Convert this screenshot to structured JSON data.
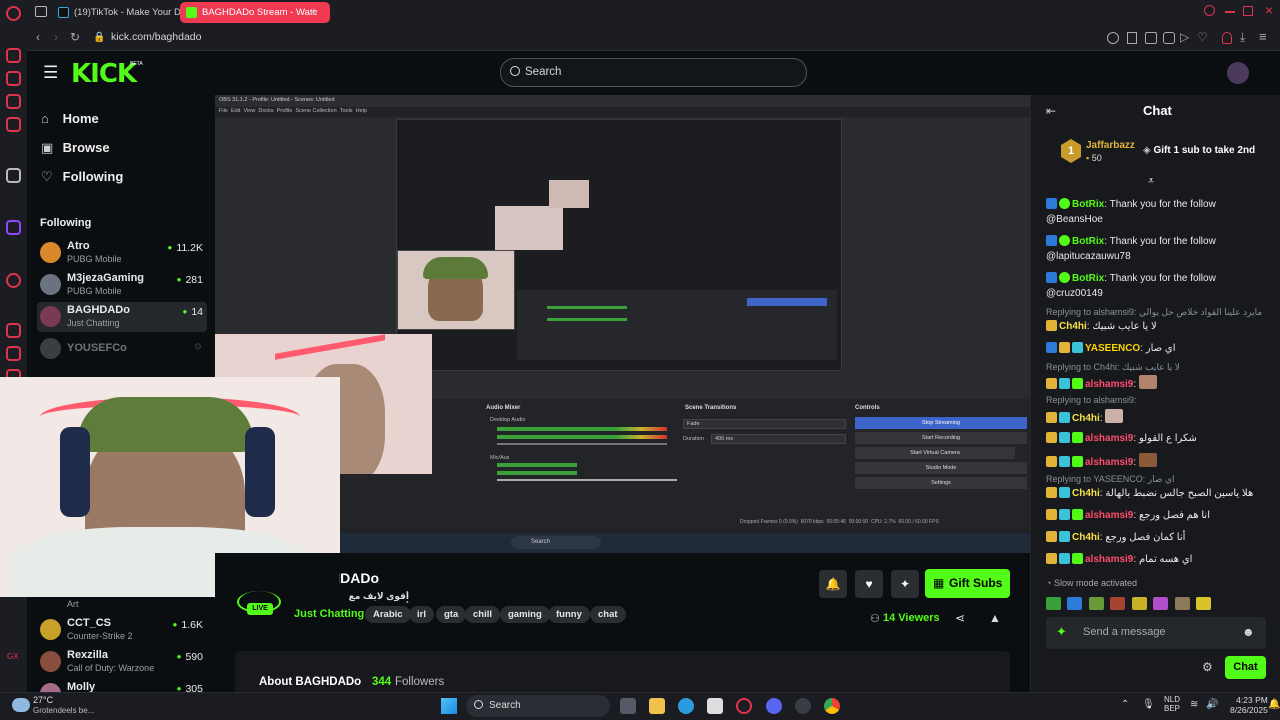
{
  "browser": {
    "tabs": [
      {
        "title": "(19)TikTok - Make Your Da"
      },
      {
        "title": "BAGHDADo Stream - Watc"
      }
    ],
    "url": "kick.com/baghdado"
  },
  "header": {
    "logo": "KICK",
    "logo_badge": "BETA",
    "search_placeholder": "Search"
  },
  "nav": {
    "items": [
      {
        "label": "Home",
        "icon": "home-icon"
      },
      {
        "label": "Browse",
        "icon": "browse-icon"
      },
      {
        "label": "Following",
        "icon": "heart-icon"
      }
    ],
    "following_heading": "Following",
    "following": [
      {
        "name": "Atro",
        "game": "PUBG Mobile",
        "viewers": "11.2K",
        "color": "#d9892b"
      },
      {
        "name": "M3jezaGaming",
        "game": "PUBG Mobile",
        "viewers": "281",
        "color": "#6b7280"
      },
      {
        "name": "BAGHDADo",
        "game": "Just Chatting",
        "viewers": "14",
        "color": "#7a3b52"
      },
      {
        "name": "YOUSEFCo",
        "game": "",
        "viewers": "",
        "color": "#555"
      }
    ],
    "lower": [
      {
        "name": "CCT_CS",
        "game": "Counter-Strike 2",
        "viewers": "1.6K",
        "color": "#c8a12a"
      },
      {
        "name": "Rexzilla",
        "game": "Call of Duty: Warzone",
        "viewers": "590",
        "color": "#8a4f3c"
      },
      {
        "name": "Molly",
        "game": "",
        "viewers": "305",
        "color": "#a46a8a"
      }
    ],
    "art_label": "Art"
  },
  "obs": {
    "title": "OBS 31.1.2 - Profile: Untitled - Scenes: Untitled",
    "menu": [
      "File",
      "Edit",
      "View",
      "Docks",
      "Profile",
      "Scene Collection",
      "Tools",
      "Help"
    ],
    "audio_mixer": "Audio Mixer",
    "desktop_audio": "Desktop Audio",
    "mic_aux": "Mic/Aux",
    "scene_transitions": "Scene Transitions",
    "fade": "Fade",
    "duration_label": "Duration",
    "duration_value": "400 ms",
    "controls": "Controls",
    "buttons": [
      "Stop Streaming",
      "Start Recording",
      "Start Virtual Camera",
      "Studio Mode",
      "Settings"
    ],
    "status": "Dropped Frames 0 (0.0%)",
    "bitrate": "6070 kbps",
    "time": "00:05:46",
    "rec_time": "00:00:00",
    "cpu": "CPU: 2.7%",
    "fps": "60.00 / 60.00 FPS",
    "taskbar_search": "Search"
  },
  "stream": {
    "channel": "BAGHDADo",
    "title": "أقوى لايف مع أقوى ...",
    "category": "Just Chatting",
    "live": "LIVE",
    "tags": [
      "Arabic",
      "irl",
      "gta",
      "chill",
      "gaming",
      "funny",
      "chat"
    ],
    "viewers": "14 Viewers",
    "gift_subs": "Gift Subs",
    "about": "About BAGHDADo",
    "followers_count": "344",
    "followers_label": "Followers"
  },
  "chat": {
    "title": "Chat",
    "top_gifter": {
      "rank": "1",
      "name": "Jaffarbazz",
      "amount": "50",
      "cta": "Gift 1 sub to take 2nd"
    },
    "messages": [
      {
        "user": "BotRix",
        "color": "#53fc18",
        "text": "Thank you for the follow @BeansHoe"
      },
      {
        "user": "BotRix",
        "color": "#53fc18",
        "text": "Thank you for the follow @lapitucazauwu78"
      },
      {
        "user": "BotRix",
        "color": "#53fc18",
        "text": "Thank you for the follow @cruz00149"
      },
      {
        "reply": "Replying to alshamsi9: مايرد علينا القواد خلاص حل يوالي"
      },
      {
        "user": "Ch4hi",
        "color": "#f7e04a",
        "text": "لا يا عايب شبيك"
      },
      {
        "user": "YASEENCO",
        "color": "#ffd400",
        "text": "اي صار"
      },
      {
        "reply": "Replying to Ch4hi: لا يا عايب شبيك"
      },
      {
        "user": "alshamsi9",
        "color": "#ff4d6d",
        "text": ""
      },
      {
        "reply": "Replying to alshamsi9:"
      },
      {
        "user": "Ch4hi",
        "color": "#f7e04a",
        "text": ""
      },
      {
        "user": "alshamsi9",
        "color": "#ff4d6d",
        "text": "شكرا ع القولو"
      },
      {
        "user": "alshamsi9",
        "color": "#ff4d6d",
        "text": ""
      },
      {
        "reply": "Replying to YASEENCO: اي صار"
      },
      {
        "user": "Ch4hi",
        "color": "#f7e04a",
        "text": "هلا ياسين الصبح جالس نضبط بالهالة"
      },
      {
        "user": "alshamsi9",
        "color": "#ff4d6d",
        "text": "انا هم فصل ورجع"
      },
      {
        "user": "Ch4hi",
        "color": "#f7e04a",
        "text": "أنا كمان فصل ورجع"
      },
      {
        "user": "alshamsi9",
        "color": "#ff4d6d",
        "text": "اي هسه تمام"
      }
    ],
    "slow_mode": "Slow mode activated",
    "input_placeholder": "Send a message",
    "send_label": "Chat"
  },
  "taskbar": {
    "weather_temp": "27°C",
    "weather_desc": "Grotendeels be...",
    "search": "Search",
    "lang": "NLD",
    "lang2": "BEP",
    "time": "4:23 PM",
    "date": "8/26/2025"
  },
  "colors": {
    "accent": "#53fc18",
    "opera": "#ef3a52"
  }
}
